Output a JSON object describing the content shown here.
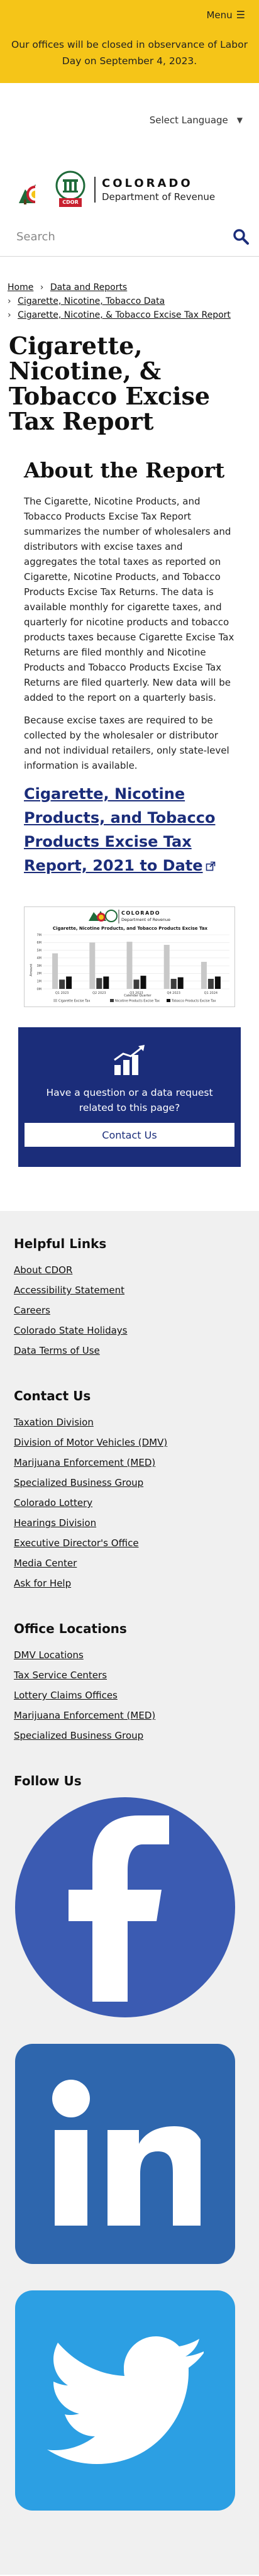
{
  "alert": {
    "menu_label": "Menu",
    "text": "Our offices will be closed in observance of Labor Day on September 4, 2023."
  },
  "header": {
    "language_label": "Select Language",
    "logo_state": "COLORADO",
    "logo_dept": "Department of Revenue",
    "seal_text": "CDOR",
    "search_placeholder": "Search"
  },
  "breadcrumb": [
    {
      "label": "Home"
    },
    {
      "label": "Data and Reports"
    },
    {
      "label": "Cigarette, Nicotine, Tobacco Data"
    },
    {
      "label": "Cigarette, Nicotine, & Tobacco Excise Tax Report"
    }
  ],
  "page_title": "Cigarette, Nicotine, & Tobacco Excise Tax Report",
  "about": {
    "heading": "About the Report",
    "para1": "The Cigarette, Nicotine Products, and Tobacco Products Excise Tax Report summarizes the number of wholesalers and distributors with excise taxes and aggregates the total taxes as reported on Cigarette, Nicotine Products, and Tobacco Products Excise Tax Returns. The data is available monthly for cigarette taxes, and quarterly for nicotine products and tobacco products taxes because Cigarette Excise Tax Returns are filed monthly and Nicotine Products and Tobacco Products Excise Tax Returns are filed quarterly. New data will be added to the report on a quarterly basis.",
    "para2": "Because excise taxes are required to be collected by the wholesaler or distributor and not individual retailers, only state-level information is available.",
    "link_label": "Cigarette, Nicotine Products, and Tobacco Products Excise Tax Report, 2021 to Date"
  },
  "chart_thumb": {
    "logo_state": "COLORADO",
    "logo_dept": "Department of Revenue",
    "title": "Cigarette, Nicotine Products, and Tobacco Products Excise Tax",
    "legend": [
      "Cigarette Excise Tax",
      "Nicotine Products Excise Tax",
      "Tobacco Products Excise Tax"
    ],
    "xlabel": "Calendar Quarter",
    "ylabel": "Amount"
  },
  "chart_data": {
    "type": "bar",
    "title": "Cigarette, Nicotine Products, and Tobacco Products Excise Tax",
    "xlabel": "Calendar Quarter",
    "ylabel": "Amount",
    "categories": [
      "Q1 2023",
      "Q2 2023",
      "Q3 2023",
      "Q4 2023",
      "Q1 2024"
    ],
    "y_ticks": [
      "0M",
      "1M",
      "2M",
      "3M",
      "4M",
      "5M",
      "6M",
      "7M"
    ],
    "ylim": [
      0,
      7
    ],
    "series": [
      {
        "name": "Cigarette Excise Tax",
        "color": "#c8c8c8",
        "values": [
          4.6,
          6.0,
          6.1,
          5.7,
          3.5
        ]
      },
      {
        "name": "Nicotine Products Excise Tax",
        "color": "#3c3c3c",
        "values": [
          1.2,
          1.4,
          1.2,
          1.3,
          1.3
        ]
      },
      {
        "name": "Tobacco Products Excise Tax",
        "color": "#0e0e0e",
        "values": [
          1.6,
          1.6,
          1.7,
          1.5,
          1.6
        ]
      }
    ]
  },
  "cta": {
    "text": "Have a question or a data request related to this page?",
    "button_label": "Contact Us"
  },
  "footer": {
    "helpful_heading": "Helpful Links",
    "helpful_links": [
      "About CDOR",
      "Accessibility Statement",
      "Careers",
      "Colorado State Holidays",
      "Data Terms of Use"
    ],
    "contact_heading": "Contact Us",
    "contact_links": [
      "Taxation Division",
      "Division of Motor Vehicles (DMV)",
      "Marijuana Enforcement (MED)",
      "Specialized Business Group",
      "Colorado Lottery",
      "Hearings Division",
      "Executive Director's Office",
      "Media Center",
      "Ask for Help"
    ],
    "locations_heading": "Office Locations",
    "location_links": [
      "DMV Locations",
      "Tax Service Centers",
      "Lottery Claims Offices",
      "Marijuana Enforcement (MED)",
      "Specialized Business Group"
    ],
    "follow_heading": "Follow Us",
    "social": [
      {
        "name": "facebook",
        "icon": "facebook-icon",
        "color": "#3b5bb2"
      },
      {
        "name": "linkedin",
        "icon": "linkedin-icon",
        "color": "#2e66ad"
      },
      {
        "name": "twitter",
        "icon": "twitter-icon",
        "color": "#2c9fe3"
      }
    ]
  }
}
